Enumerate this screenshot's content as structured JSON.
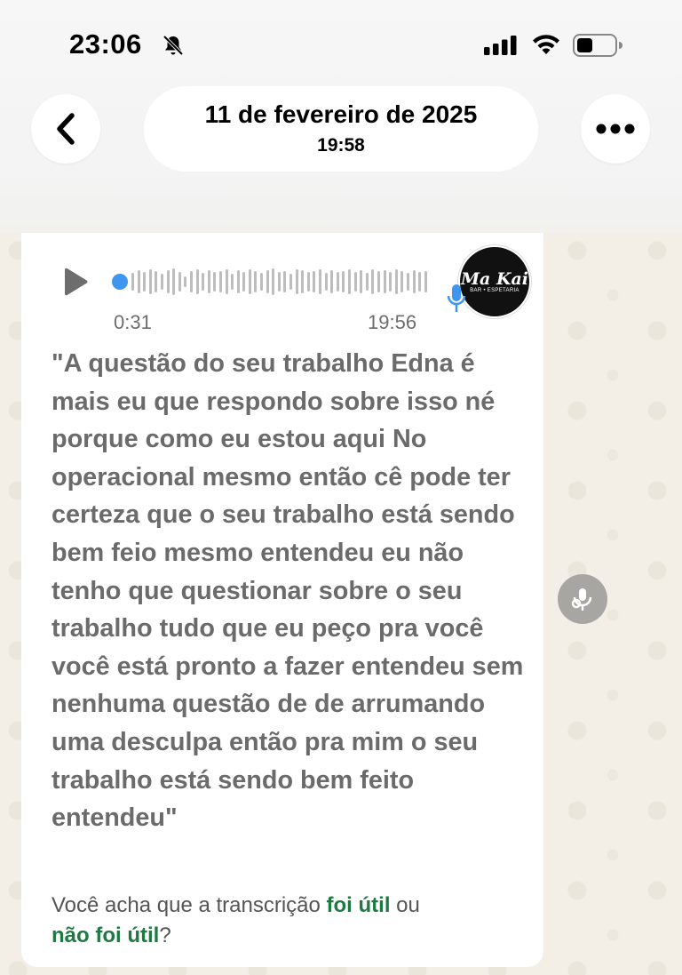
{
  "status_bar": {
    "time": "23:06"
  },
  "header": {
    "date": "11 de fevereiro de 2025",
    "time": "19:58"
  },
  "audio": {
    "duration": "0:31",
    "timestamp": "19:56",
    "avatar_logo": "Ma Kai",
    "avatar_sub": "BAR • ESPETARIA"
  },
  "transcript": "\"A questão do seu trabalho Edna é mais eu que respondo sobre isso né porque como eu estou aqui No operacional mesmo então cê pode ter certeza que o seu trabalho está sendo bem feio mesmo entendeu eu não tenho que questionar sobre o seu trabalho tudo que eu peço pra você você está pronto a fazer entendeu sem nenhuma questão de de arrumando uma desculpa então pra mim o seu trabalho está sendo bem feito entendeu\"",
  "feedback": {
    "prefix": "Você acha que a transcrição ",
    "useful": "foi útil",
    "middle": " ou",
    "not_useful": "não foi útil",
    "suffix": "?"
  },
  "colors": {
    "link_green": "#1e7a42",
    "waveform_dot": "#3e96ee"
  }
}
